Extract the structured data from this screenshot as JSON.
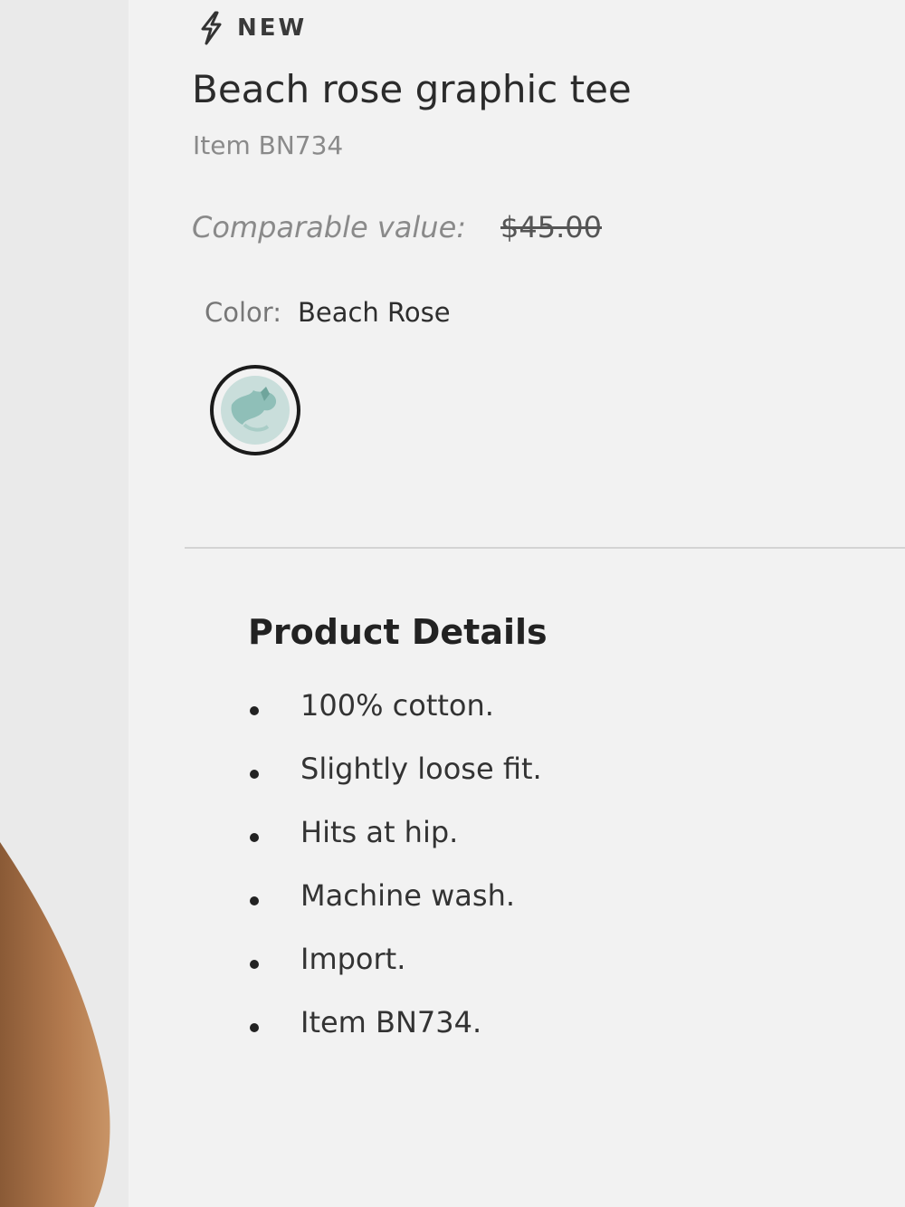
{
  "product": {
    "badge_icon": "lightning-bolt-icon",
    "badge": "NEW",
    "title": "Beach rose graphic tee",
    "item_number": "Item BN734",
    "comparable_label": "Comparable value:",
    "comparable_price": "$45.00",
    "color_label": "Color:",
    "color_value": "Beach Rose",
    "swatch_colors": [
      "#8fbfb8",
      "#c9dedb",
      "#6fa59c"
    ]
  },
  "details": {
    "heading": "Product Details",
    "items": [
      "100% cotton.",
      "Slightly loose fit.",
      "Hits at hip.",
      "Machine wash.",
      "Import.",
      "Item BN734."
    ]
  }
}
